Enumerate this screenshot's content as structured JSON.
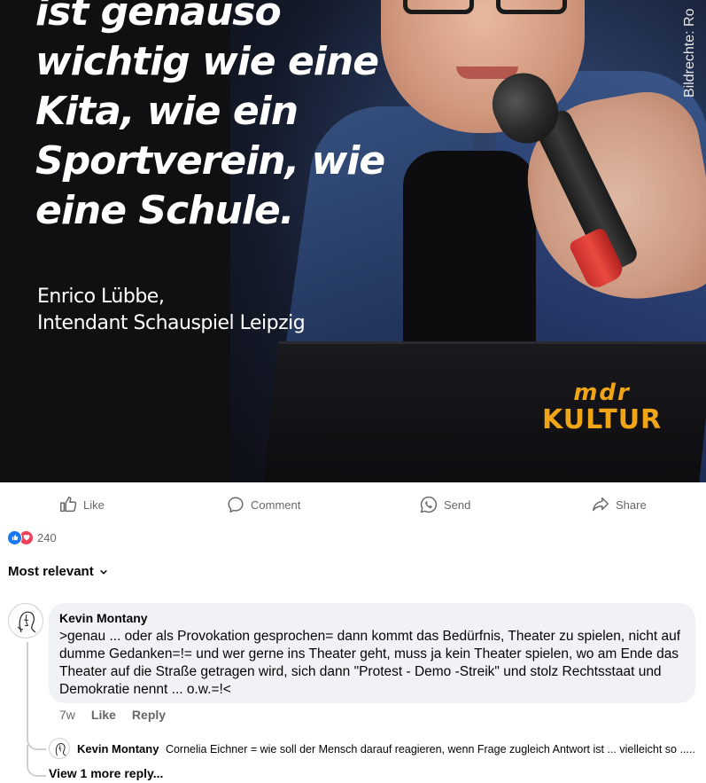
{
  "post_image": {
    "quote_lines": [
      "ist genauso",
      "wichtig wie eine",
      "Kita, wie ein",
      "Sportverein, wie",
      "eine Schule."
    ],
    "attribution_name": "Enrico Lübbe,",
    "attribution_title": "Intendant Schauspiel Leipzig",
    "logo_mark": "mdr",
    "logo_text": "KULTUR",
    "credit": "Bildrechte: Ro"
  },
  "actions": {
    "like": "Like",
    "comment": "Comment",
    "send": "Send",
    "share": "Share"
  },
  "reactions": {
    "count": "240",
    "icons": [
      "like-icon",
      "love-icon"
    ]
  },
  "sort": {
    "label": "Most relevant"
  },
  "comment": {
    "author": "Kevin Montany",
    "text": ">genau ... oder als Provokation gesprochen= dann kommt das Bedürfnis, Theater zu spielen, nicht auf dumme Gedanken=!= und wer gerne ins Theater geht, muss ja kein Theater spielen, wo am Ende das Theater auf die Straße getragen wird, sich dann \"Protest - Demo -Streik\"  und  stolz Rechtsstaat und Demokratie nennt ... o.w.=!<",
    "time": "7w",
    "like": "Like",
    "reply": "Reply"
  },
  "reply": {
    "author": "Kevin Montany",
    "text": "Cornelia Eichner = wie soll der Mensch darauf reagieren, wenn Frage zugleich Antwort ist ... vielleicht so ....."
  },
  "view_more": "View 1 more reply...",
  "colors": {
    "like_blue": "#1877f2",
    "love_red": "#f33e58",
    "bubble_bg": "#f0f2f5",
    "secondary_text": "#65676b",
    "logo_gold": "#f0a516"
  }
}
